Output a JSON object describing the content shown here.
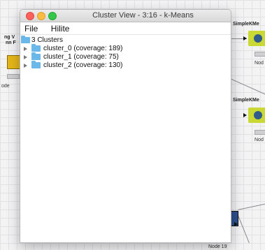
{
  "window": {
    "title": "Cluster View - 3:16 - k-Means"
  },
  "menu": {
    "file": "File",
    "hilite": "Hilite"
  },
  "tree": {
    "root_label": "3 Clusters",
    "items": [
      {
        "label": "cluster_0 (coverage: 189)"
      },
      {
        "label": "cluster_1 (coverage: 75)"
      },
      {
        "label": "cluster_2 (coverage: 130)"
      }
    ]
  },
  "background": {
    "node_a_label_line1": "ng V",
    "node_a_label_line2": "nn F",
    "node_a_caption": "ode",
    "node_b_label": "SimpleKMe",
    "node_b_caption": "Nod",
    "node_c_label": "SimpleKMe",
    "node_c_caption": "Nod",
    "node_d_caption": "Node 19"
  },
  "colors": {
    "folder": "#6ab7ea",
    "node_green": "#c9d833",
    "node_yellow": "#e5b61a"
  }
}
